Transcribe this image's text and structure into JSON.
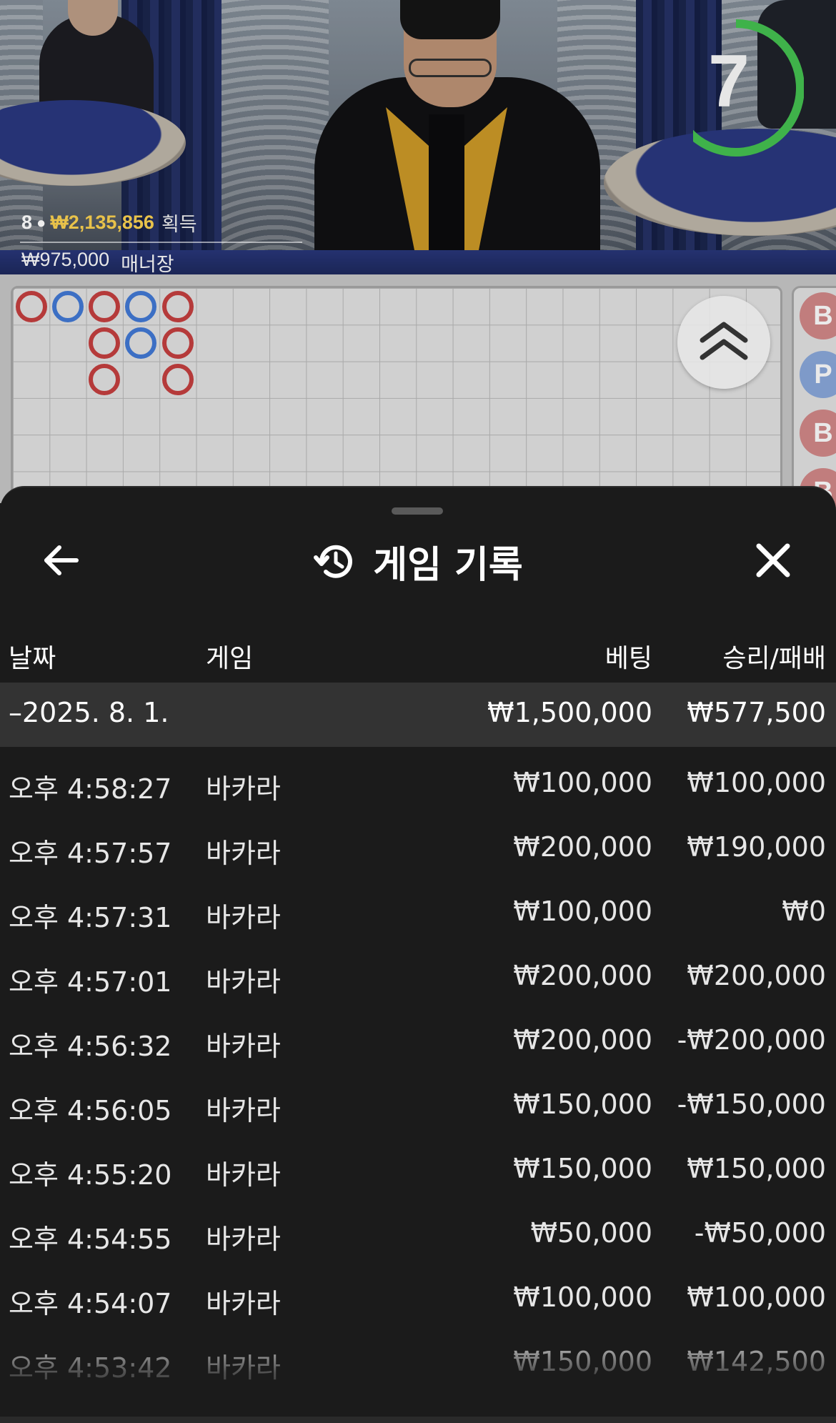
{
  "video": {
    "timer": "7",
    "timer_progress": 0.72,
    "player_count": "8",
    "win_amount": "₩2,135,856",
    "win_label": "획득",
    "manager_amount": "₩975,000",
    "manager_label": "매너장"
  },
  "bead_road": {
    "columns": [
      [
        "red"
      ],
      [
        "blue"
      ],
      [
        "red",
        "red",
        "red"
      ],
      [
        "blue",
        "blue"
      ],
      [
        "red",
        "red",
        "red"
      ]
    ],
    "side_letters": [
      "B",
      "P",
      "B",
      "B"
    ]
  },
  "sheet": {
    "title": "게임 기록",
    "columns": {
      "date": "날짜",
      "game": "게임",
      "bet": "베팅",
      "result": "승리/패배"
    },
    "date_group": {
      "date": "–2025. 8. 1.",
      "bet_total": "₩1,500,000",
      "result_total": "₩577,500"
    },
    "rows": [
      {
        "time": "오후 4:58:27",
        "game": "바카라",
        "bet": "₩100,000",
        "result": "₩100,000"
      },
      {
        "time": "오후 4:57:57",
        "game": "바카라",
        "bet": "₩200,000",
        "result": "₩190,000"
      },
      {
        "time": "오후 4:57:31",
        "game": "바카라",
        "bet": "₩100,000",
        "result": "₩0"
      },
      {
        "time": "오후 4:57:01",
        "game": "바카라",
        "bet": "₩200,000",
        "result": "₩200,000"
      },
      {
        "time": "오후 4:56:32",
        "game": "바카라",
        "bet": "₩200,000",
        "result": "-₩200,000"
      },
      {
        "time": "오후 4:56:05",
        "game": "바카라",
        "bet": "₩150,000",
        "result": "-₩150,000"
      },
      {
        "time": "오후 4:55:20",
        "game": "바카라",
        "bet": "₩150,000",
        "result": "₩150,000"
      },
      {
        "time": "오후 4:54:55",
        "game": "바카라",
        "bet": "₩50,000",
        "result": "-₩50,000"
      },
      {
        "time": "오후 4:54:07",
        "game": "바카라",
        "bet": "₩100,000",
        "result": "₩100,000"
      },
      {
        "time": "오후 4:53:42",
        "game": "바카라",
        "bet": "₩150,000",
        "result": "₩142,500"
      }
    ]
  },
  "colors": {
    "banker": "#b53a3a",
    "player": "#3c6fc4",
    "timer_ring": "#3fb24a",
    "win_gold": "#e8c24a"
  }
}
